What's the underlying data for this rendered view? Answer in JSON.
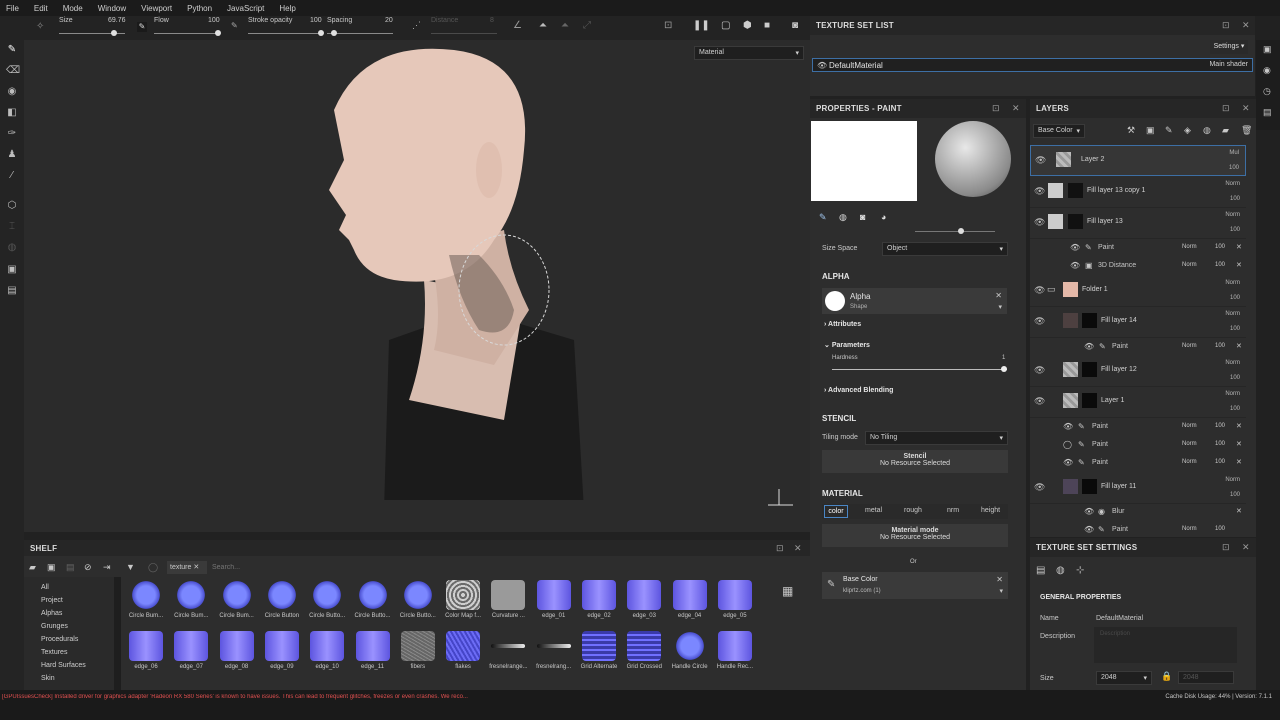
{
  "menu": [
    "File",
    "Edit",
    "Mode",
    "Window",
    "Viewport",
    "Python",
    "JavaScript",
    "Help"
  ],
  "toolbar": {
    "size_label": "Size",
    "size_value": "69.76",
    "flow_label": "Flow",
    "flow_value": "100",
    "stroke_label": "Stroke opacity",
    "stroke_value": "100",
    "spacing_label": "Spacing",
    "spacing_value": "20",
    "distance_label": "Distance",
    "distance_value": "8",
    "viewmode": "Material"
  },
  "texture_set_list": {
    "title": "TEXTURE SET LIST",
    "settings": "Settings",
    "material": "DefaultMaterial",
    "shader": "Main shader"
  },
  "properties": {
    "title": "PROPERTIES - PAINT",
    "size_space_label": "Size Space",
    "size_space_value": "Object",
    "alpha_header": "ALPHA",
    "alpha_name": "Alpha",
    "alpha_sub": "Shape",
    "attributes": "Attributes",
    "parameters": "Parameters",
    "hardness_label": "Hardness",
    "hardness_value": "1",
    "advanced": "Advanced Blending",
    "stencil_header": "STENCIL",
    "tiling_label": "Tiling mode",
    "tiling_value": "No Tiling",
    "stencil_btn": "Stencil",
    "stencil_none": "No Resource Selected",
    "material_header": "MATERIAL",
    "channels": [
      "color",
      "metal",
      "rough",
      "nrm",
      "height"
    ],
    "material_mode": "Material mode",
    "material_none": "No Resource Selected",
    "or": "Or",
    "base_color": "Base Color",
    "base_color_src": "kliprtz.com (1)"
  },
  "layers": {
    "title": "LAYERS",
    "channel": "Base Color",
    "items": [
      {
        "name": "Layer 2",
        "mode": "Mul",
        "opacity": "100"
      },
      {
        "name": "Fill layer 13 copy 1",
        "mode": "Norm",
        "opacity": "100"
      },
      {
        "name": "Fill layer 13",
        "mode": "Norm",
        "opacity": "100"
      },
      {
        "name": "Paint",
        "mode": "Norm",
        "opacity": "100"
      },
      {
        "name": "3D Distance",
        "mode": "Norm",
        "opacity": "100"
      },
      {
        "name": "Folder 1",
        "mode": "Norm",
        "opacity": "100"
      },
      {
        "name": "Fill layer 14",
        "mode": "Norm",
        "opacity": "100"
      },
      {
        "name": "Paint",
        "mode": "Norm",
        "opacity": "100"
      },
      {
        "name": "Fill layer 12",
        "mode": "Norm",
        "opacity": "100"
      },
      {
        "name": "Layer 1",
        "mode": "Norm",
        "opacity": "100"
      },
      {
        "name": "Paint",
        "mode": "Norm",
        "opacity": "100"
      },
      {
        "name": "Paint",
        "mode": "Norm",
        "opacity": "100"
      },
      {
        "name": "Paint",
        "mode": "Norm",
        "opacity": "100"
      },
      {
        "name": "Fill layer 11",
        "mode": "Norm",
        "opacity": "100"
      },
      {
        "name": "Blur",
        "mode": "",
        "opacity": ""
      },
      {
        "name": "Paint",
        "mode": "Norm",
        "opacity": "100"
      }
    ]
  },
  "tss": {
    "title": "TEXTURE SET SETTINGS",
    "general": "GENERAL PROPERTIES",
    "name_label": "Name",
    "name_value": "DefaultMaterial",
    "desc_label": "Description",
    "desc_placeholder": "Description",
    "size_label": "Size",
    "size_value": "2048",
    "size_locked": "2048"
  },
  "shelf": {
    "title": "SHELF",
    "filter": "texture",
    "search_placeholder": "Search...",
    "categories": [
      "All",
      "Project",
      "Alphas",
      "Grunges",
      "Procedurals",
      "Textures",
      "Hard Surfaces",
      "Skin"
    ],
    "row1": [
      "Circle Bum...",
      "Circle Bum...",
      "Circle Bum...",
      "Circle Button",
      "Circle Butto...",
      "Circle Butto...",
      "Circle Butto...",
      "Color Map f...",
      "Curvature ...",
      "edge_01",
      "edge_02",
      "edge_03",
      "edge_04",
      "edge_05"
    ],
    "row2": [
      "edge_06",
      "edge_07",
      "edge_08",
      "edge_09",
      "edge_10",
      "edge_11",
      "fibers",
      "flakes",
      "fresnelrange...",
      "fresnelrang...",
      "Grid Alternate",
      "Grid Crossed",
      "Handle Circle",
      "Handle Rec..."
    ]
  },
  "status": {
    "warning": "[GPUIssuesCheck] Installed driver for graphics adapter 'Radeon RX 580 Series' is known to have issues. This can lead to frequent glitches, freezes or even crashes. We reco...",
    "cache": "Cache Disk Usage:  44% | Version: 7.1.1"
  }
}
